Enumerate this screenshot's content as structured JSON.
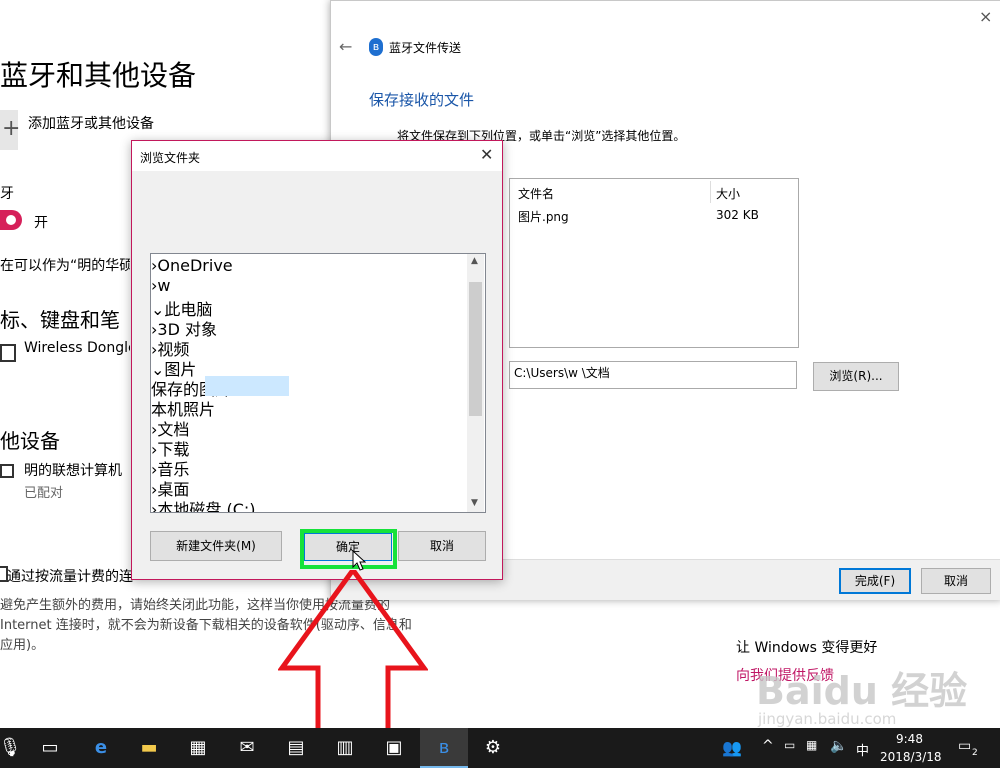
{
  "settings": {
    "title": "蓝牙和其他设备",
    "add_device": "添加蓝牙或其他设备",
    "bt_label": "牙",
    "bt_state": "开",
    "discoverable": "在可以作为“明的华硕",
    "section_mouse": "标、键盘和笔",
    "device1": "Wireless Dongle",
    "section_other": "他设备",
    "device2": "明的联想计算机",
    "device2_status": "已配对",
    "metered_label": "通过按流量计费的连",
    "info_text": "避免产生额外的费用，请始终关闭此功能，这样当你使用按流量费的 Internet 连接时，就不会为新设备下载相关的设备软件(驱动序、信息和应用)。",
    "improve_title": "让 Windows 变得更好",
    "feedback_link": "向我们提供反馈"
  },
  "bt_window": {
    "close": "×",
    "back": "←",
    "title": "蓝牙文件传送",
    "heading": "保存接收的文件",
    "description": "将文件保存到下列位置，或单击“浏览”选择其他位置。",
    "columns": [
      "文件名",
      "大小"
    ],
    "file": {
      "name": "图片.png",
      "size": "302 KB"
    },
    "path": "C:\\Users\\w        \\文档",
    "browse_label": "浏览(R)...",
    "finish_label": "完成(F)",
    "cancel_label": "取消"
  },
  "dialog": {
    "title": "浏览文件夹",
    "close": "✕",
    "tree": [
      {
        "label": "OneDrive",
        "icon": "cloud-icon",
        "level": 0,
        "arrow": ">"
      },
      {
        "label": "w",
        "icon": "user-icon",
        "level": 0,
        "arrow": ">"
      },
      {
        "label": "此电脑",
        "icon": "computer-icon",
        "level": 0,
        "arrow": "v"
      },
      {
        "label": "3D 对象",
        "icon": "cube-icon",
        "level": 1,
        "arrow": ">"
      },
      {
        "label": "视频",
        "icon": "video-icon",
        "level": 1,
        "arrow": ">"
      },
      {
        "label": "图片",
        "icon": "pictures-icon",
        "level": 1,
        "arrow": "v"
      },
      {
        "label": "保存的图片",
        "icon": "folder-icon",
        "level": 2,
        "arrow": "",
        "selected": true
      },
      {
        "label": "本机照片",
        "icon": "folder-icon",
        "level": 2,
        "arrow": ""
      },
      {
        "label": "文档",
        "icon": "document-icon",
        "level": 1,
        "arrow": ">"
      },
      {
        "label": "下载",
        "icon": "download-icon",
        "level": 1,
        "arrow": ">"
      },
      {
        "label": "音乐",
        "icon": "music-icon",
        "level": 1,
        "arrow": ">"
      },
      {
        "label": "桌面",
        "icon": "desktop-icon",
        "level": 1,
        "arrow": ">"
      },
      {
        "label": "本地磁盘 (C:)",
        "icon": "disk-icon",
        "level": 1,
        "arrow": ">"
      }
    ],
    "new_folder_label": "新建文件夹(M)",
    "ok_label": "确定",
    "cancel_label": "取消"
  },
  "taskbar": {
    "time": "9:48",
    "date": "2018/3/18",
    "ime": "中",
    "notification_count": "2"
  },
  "watermark": {
    "brand": "Baidu 经验",
    "site": "jingyan.baidu.com"
  },
  "colors": {
    "accent": "#1a56a8",
    "pink": "#c01765",
    "highlight": "#16e23a",
    "arrow": "#e8141c"
  }
}
